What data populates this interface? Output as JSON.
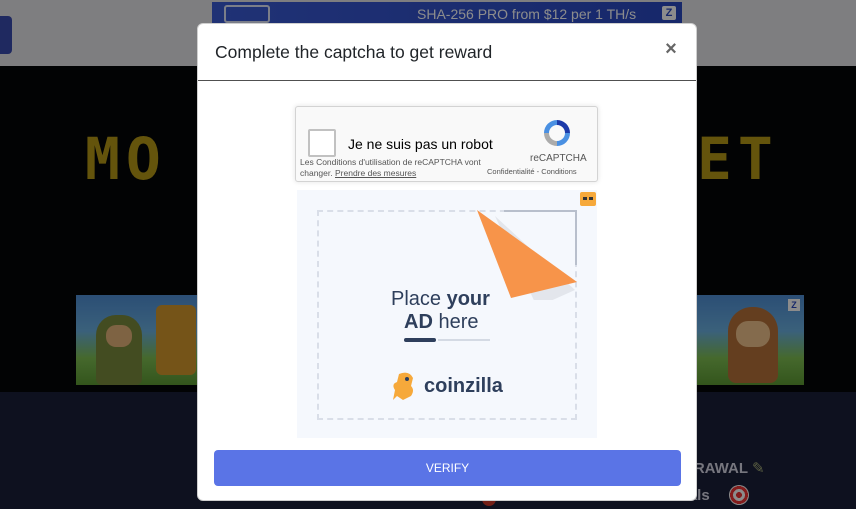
{
  "background": {
    "banner_text": "SHA-256 PRO from $12 per 1 TH/s",
    "banner_badge": "Z",
    "site_title_left": "MO",
    "site_title_right": "ET",
    "withdraw_text": "DRAWAL",
    "referrals_text": "rals",
    "ad_badge": "Z"
  },
  "modal": {
    "title": "Complete the captcha to get reward",
    "close_symbol": "×",
    "verify_label": "VERIFY"
  },
  "recaptcha": {
    "label": "Je ne suis pas un robot",
    "terms_text": "Les Conditions d'utilisation de reCAPTCHA vont changer.",
    "terms_link": "Prendre des mesures",
    "brand": "reCAPTCHA",
    "privacy": "Confidentialité - Conditions"
  },
  "ad": {
    "line1_normal": "Place",
    "line1_bold": "your",
    "line2_bold": "AD",
    "line2_normal": "here",
    "brand": "coinzilla"
  },
  "colors": {
    "accent": "#5a74e6",
    "arrow": "#f7944a",
    "ad_text": "#2e3f5c"
  }
}
